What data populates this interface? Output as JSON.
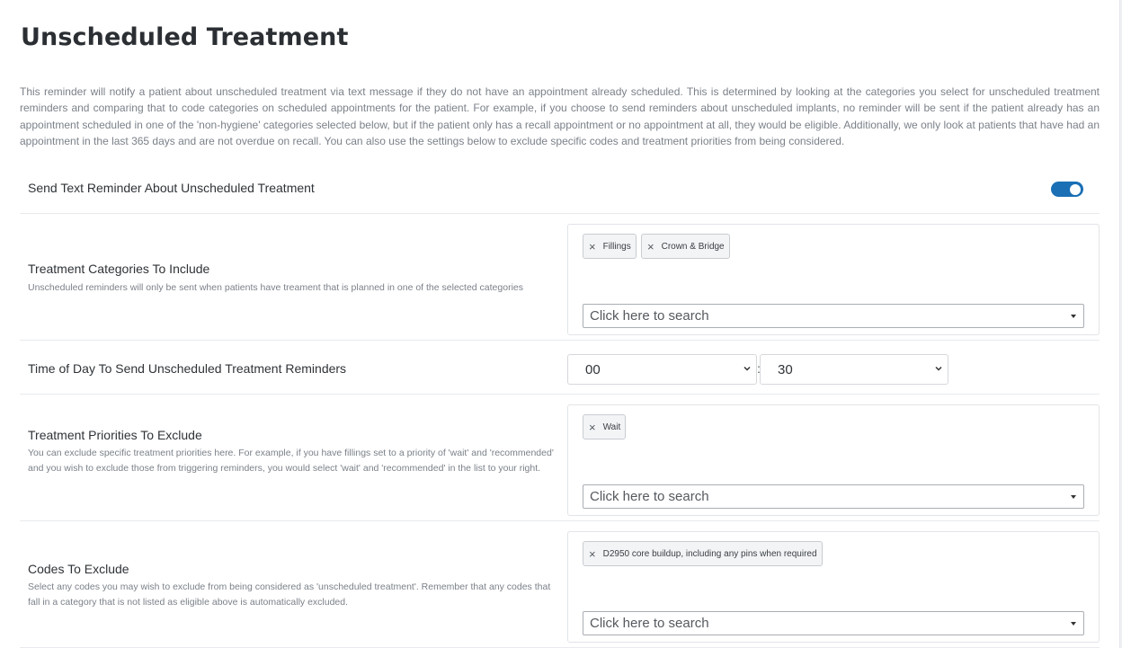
{
  "page": {
    "title": "Unscheduled Treatment",
    "description": "This reminder will notify a patient about unscheduled treatment via text message if they do not have an appointment already scheduled. This is determined by looking at the categories you select for unscheduled treatment reminders and comparing that to code categories on scheduled appointments for the patient. For example, if you choose to send reminders about unscheduled implants, no reminder will be sent if the patient already has an appointment scheduled in one of the 'non-hygiene' categories selected below, but if the patient only has a recall appointment or no appointment at all, they would be eligible. Additionally, we only look at patients that have had an appointment in the last 365 days and are not overdue on recall. You can also use the settings below to exclude specific codes and treatment priorities from being considered."
  },
  "send_text": {
    "label": "Send Text Reminder About Unscheduled Treatment",
    "enabled": true,
    "toggle_color": "#1a6fb5"
  },
  "categories": {
    "label": "Treatment Categories To Include",
    "help": "Unscheduled reminders will only be sent when patients have treament that is planned in one of the selected categories",
    "selected": [
      "Fillings",
      "Crown & Bridge"
    ],
    "search_placeholder": "Click here to search"
  },
  "time_of_day": {
    "label": "Time of Day To Send Unscheduled Treatment Reminders",
    "hour": "00",
    "separator": ":",
    "minute": "30"
  },
  "priorities": {
    "label": "Treatment Priorities To Exclude",
    "help": "You can exclude specific treatment priorities here. For example, if you have fillings set to a priority of 'wait' and 'recommended' and you wish to exclude those from triggering reminders, you would select 'wait' and 'recommended' in the list to your right.",
    "selected": [
      "Wait"
    ],
    "search_placeholder": "Click here to search"
  },
  "codes": {
    "label": "Codes To Exclude",
    "help": "Select any codes you may wish to exclude from being considered as 'unscheduled treatment'. Remember that any codes that fall in a category that is not listed as eligible above is automatically excluded.",
    "selected": [
      "D2950 core buildup, including any pins when required"
    ],
    "search_placeholder": "Click here to search"
  },
  "icons": {
    "chip_remove": "close-icon",
    "dropdown": "caret-down-icon",
    "select": "chevron-down-icon",
    "chip_remove_glyph": "×"
  }
}
